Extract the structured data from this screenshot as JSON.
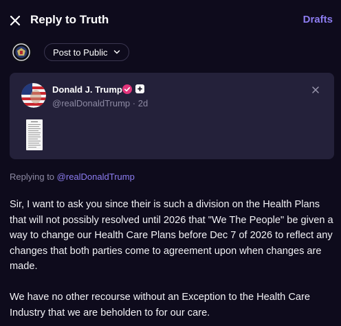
{
  "header": {
    "title": "Reply to Truth",
    "drafts_label": "Drafts"
  },
  "composer": {
    "privacy_label": "Post to Public"
  },
  "quoted_post": {
    "author_name": "Donald J. Trump",
    "handle": "@realDonaldTrump",
    "separator": "·",
    "time": "2d"
  },
  "replying": {
    "prefix": "Replying to",
    "handle": "@realDonaldTrump"
  },
  "body": {
    "paragraph1": "Sir, I want to ask you since their is such a division on the Health Plans that will not possibly resolved until 2026 that \"We The People\" be given a way to change our Health Care Plans before Dec 7 of 2026 to reflect any changes that both parties come to agreement upon when changes are made.",
    "paragraph2": "We have no other recourse without an Exception to the Health Care Industry that we are beholden to for our care."
  },
  "colors": {
    "background": "#0e0b1c",
    "card": "#24213a",
    "accent": "#8c7cf0",
    "muted": "#8d8aa3",
    "verified": "#e2347b"
  }
}
